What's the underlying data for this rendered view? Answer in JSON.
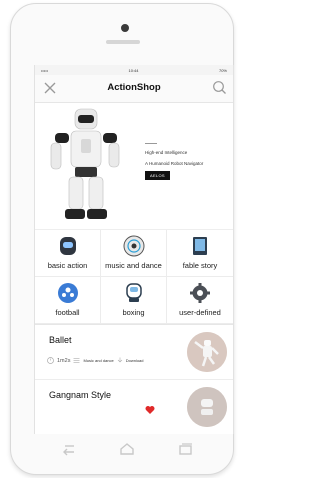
{
  "status": {
    "left": "•••••",
    "time": "10:44",
    "battery": "70%"
  },
  "header": {
    "title": "ActionShop",
    "close_icon": "close-icon",
    "search_icon": "search-icon"
  },
  "banner": {
    "line1": "High-end Intelligence",
    "line2": "A Humanoid Robot Navigator",
    "brand": "AELOS"
  },
  "categories": [
    {
      "label": "basic action",
      "icon": "robot-head-icon"
    },
    {
      "label": "music and dance",
      "icon": "music-disc-icon"
    },
    {
      "label": "fable story",
      "icon": "book-icon"
    },
    {
      "label": "football",
      "icon": "football-icon"
    },
    {
      "label": "boxing",
      "icon": "boxing-glove-icon"
    },
    {
      "label": "user-defined",
      "icon": "gear-icon"
    }
  ],
  "actions": [
    {
      "name": "Ballet",
      "duration": "1m2s",
      "category": "Music and dance",
      "download": "Download"
    },
    {
      "name": "Gangnam Style"
    }
  ],
  "colors": {
    "heart": "#e02a2a",
    "accent": "#111111"
  }
}
